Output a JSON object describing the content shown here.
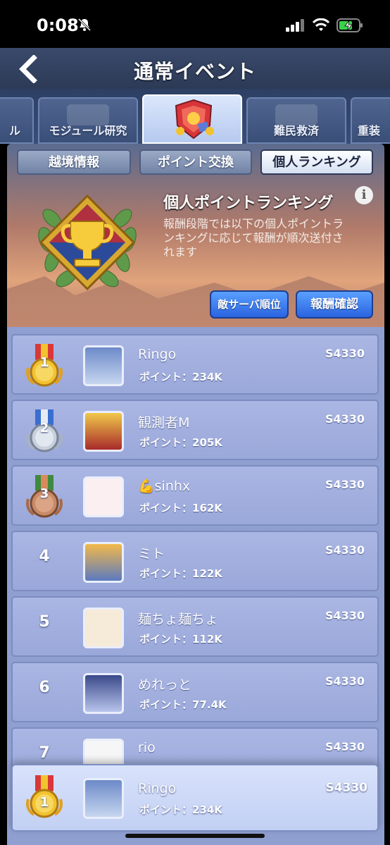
{
  "status": {
    "time": "0:08"
  },
  "header": {
    "title": "通常イベント"
  },
  "tabs": [
    {
      "label": "ル"
    },
    {
      "label": "モジュール研究"
    },
    {
      "label": ""
    },
    {
      "label": "難民救済"
    },
    {
      "label": "重装"
    }
  ],
  "subtabs": [
    {
      "label": "越境情報"
    },
    {
      "label": "ポイント交換"
    },
    {
      "label": "個人ランキング"
    }
  ],
  "banner": {
    "title": "個人ポイントランキング",
    "description": "報酬段階では以下の個人ポイントランキングに応じて報酬が順次送付されます",
    "enemy_server_button": "敵サーバ順位",
    "reward_button": "報酬確認"
  },
  "colors": {
    "gold": "#f2c230",
    "silver": "#c8d0dc",
    "bronze": "#c88a68",
    "accent": "#2a63e0"
  },
  "ranking": [
    {
      "rank": "1",
      "medal": "gold-medal-icon",
      "avatar": "avatar-silver-hair",
      "name": "Ringo",
      "points": "ポイント：234K",
      "server": "S4330"
    },
    {
      "rank": "2",
      "medal": "silver-medal-icon",
      "avatar": "avatar-blonde-red",
      "name": "観測者M",
      "points": "ポイント：205K",
      "server": "S4330"
    },
    {
      "rank": "3",
      "medal": "bronze-medal-icon",
      "avatar": "avatar-chibi",
      "name": "💪sinhx",
      "points": "ポイント：162K",
      "server": "S4330"
    },
    {
      "rank": "4",
      "avatar": "avatar-orange-hair",
      "name": "ミト",
      "points": "ポイント：122K",
      "server": "S4330"
    },
    {
      "rank": "5",
      "avatar": "avatar-cat",
      "name": "麺ちょ麺ちょ",
      "points": "ポイント：112K",
      "server": "S4330"
    },
    {
      "rank": "6",
      "avatar": "avatar-blue-hair",
      "name": "めれっと",
      "points": "ポイント：77.4K",
      "server": "S4330"
    },
    {
      "rank": "7",
      "avatar": "avatar-seal",
      "name": "rio",
      "points": "",
      "server": "S4330"
    }
  ],
  "my_rank": {
    "rank": "1",
    "name": "Ringo",
    "points": "ポイント：234K",
    "server": "S4330"
  }
}
